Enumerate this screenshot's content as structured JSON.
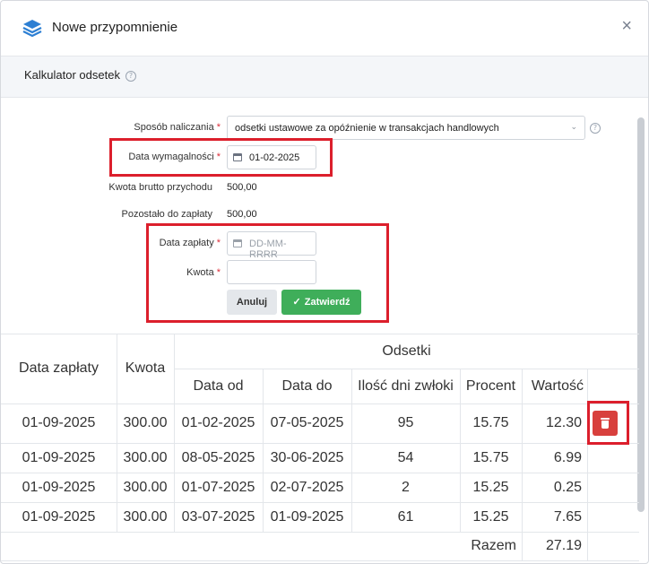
{
  "modal": {
    "title": "Nowe przypomnienie",
    "close_label": "×"
  },
  "section": {
    "title": "Kalkulator odsetek",
    "help_glyph": "?"
  },
  "form": {
    "method_label": "Sposób naliczania",
    "method_value": "odsetki ustawowe za opóźnienie w transakcjach handlowych",
    "due_date_label": "Data wymagalności",
    "due_date_value": "01-02-2025",
    "gross_label": "Kwota brutto przychodu",
    "gross_value": "500,00",
    "remaining_label": "Pozostało do zapłaty",
    "remaining_value": "500,00",
    "payment_date_label": "Data zapłaty",
    "payment_date_placeholder": "DD-MM-RRRR",
    "amount_label": "Kwota",
    "required_mark": "*",
    "cancel_label": "Anuluj",
    "confirm_label": "Zatwierdź"
  },
  "table": {
    "headers": {
      "payment_date": "Data zapłaty",
      "amount": "Kwota",
      "interest_group": "Odsetki",
      "date_from": "Data od",
      "date_to": "Data do",
      "days_late": "Ilość dni zwłoki",
      "percent": "Procent",
      "value": "Wartość"
    },
    "rows": [
      {
        "payment_date": "01-09-2025",
        "amount": "300.00",
        "date_from": "01-02-2025",
        "date_to": "07-05-2025",
        "days": "95",
        "percent": "15.75",
        "value": "12.30"
      },
      {
        "payment_date": "01-09-2025",
        "amount": "300.00",
        "date_from": "08-05-2025",
        "date_to": "30-06-2025",
        "days": "54",
        "percent": "15.75",
        "value": "6.99"
      },
      {
        "payment_date": "01-09-2025",
        "amount": "300.00",
        "date_from": "01-07-2025",
        "date_to": "02-07-2025",
        "days": "2",
        "percent": "15.25",
        "value": "0.25"
      },
      {
        "payment_date": "01-09-2025",
        "amount": "300.00",
        "date_from": "03-07-2025",
        "date_to": "01-09-2025",
        "days": "61",
        "percent": "15.25",
        "value": "7.65"
      }
    ],
    "total_label": "Razem",
    "total_value": "27.19"
  },
  "colors": {
    "accent_green": "#3fae5a",
    "danger_red": "#d8403d",
    "highlight_red": "#dc1f2c"
  }
}
